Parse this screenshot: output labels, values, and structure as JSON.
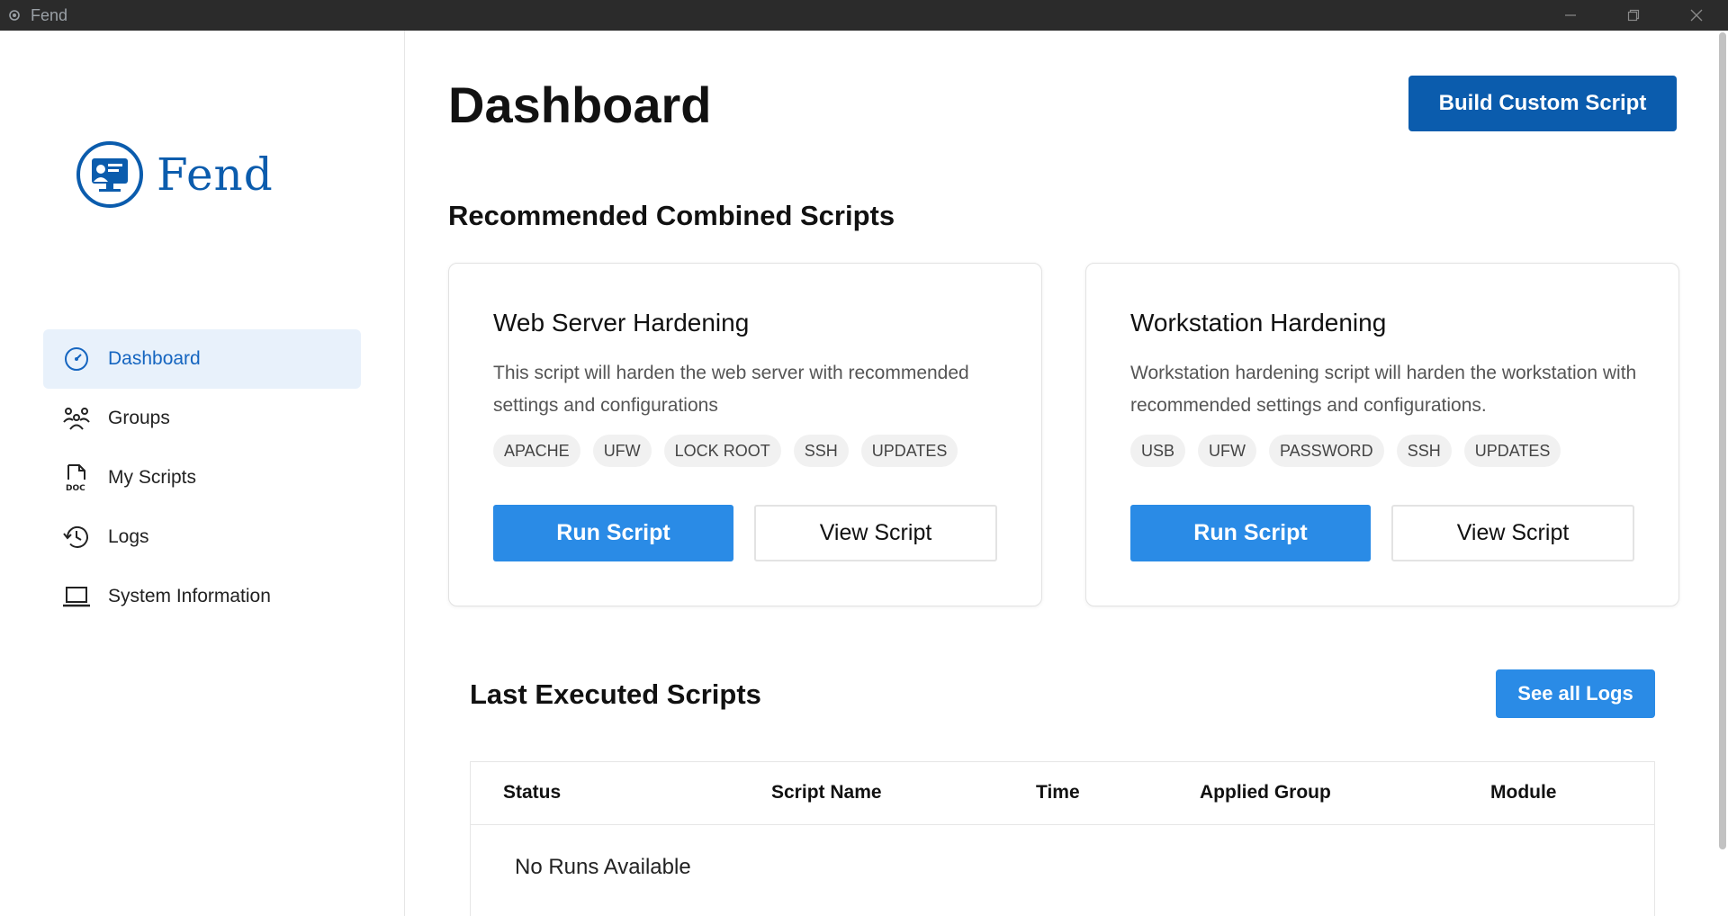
{
  "window": {
    "title": "Fend"
  },
  "sidebar": {
    "brand": "Fend",
    "items": [
      {
        "label": "Dashboard",
        "icon": "gauge-icon",
        "active": true
      },
      {
        "label": "Groups",
        "icon": "users-icon"
      },
      {
        "label": "My Scripts",
        "icon": "doc-file-icon"
      },
      {
        "label": "Logs",
        "icon": "history-icon"
      },
      {
        "label": "System Information",
        "icon": "laptop-icon"
      }
    ]
  },
  "header": {
    "title": "Dashboard",
    "build_button": "Build Custom Script"
  },
  "recommended": {
    "title": "Recommended Combined Scripts",
    "cards": [
      {
        "title": "Web Server Hardening",
        "description": "This script will harden the web server with recommended settings and configurations",
        "tags": [
          "APACHE",
          "UFW",
          "LOCK ROOT",
          "SSH",
          "UPDATES"
        ],
        "run_label": "Run Script",
        "view_label": "View Script"
      },
      {
        "title": "Workstation Hardening",
        "description": "Workstation hardening script will harden the workstation with recommended settings and configurations.",
        "tags": [
          "USB",
          "UFW",
          "PASSWORD",
          "SSH",
          "UPDATES"
        ],
        "run_label": "Run Script",
        "view_label": "View Script"
      }
    ]
  },
  "last_executed": {
    "title": "Last Executed Scripts",
    "logs_button": "See all Logs",
    "columns": [
      "Status",
      "Script Name",
      "Time",
      "Applied Group",
      "Module"
    ],
    "empty_text": "No Runs Available"
  },
  "colors": {
    "primary": "#0b5cad",
    "accent": "#2a8be6",
    "active_bg": "#e8f1fb"
  }
}
